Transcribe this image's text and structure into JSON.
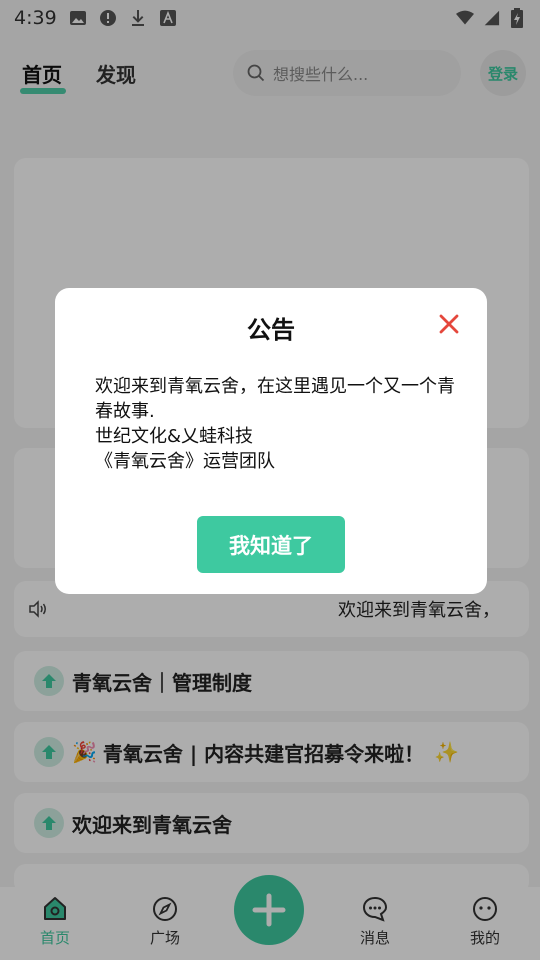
{
  "status_bar": {
    "time": "4:39",
    "icons": [
      "image-icon",
      "alert-icon",
      "download-icon",
      "font-icon"
    ],
    "right_icons": [
      "wifi-icon",
      "signal-icon",
      "battery-icon"
    ]
  },
  "header": {
    "tabs": [
      {
        "label": "首页",
        "active": true
      },
      {
        "label": "发现",
        "active": false
      }
    ],
    "search_placeholder": "想搜些什么...",
    "login_label": "登录"
  },
  "notice_bar": {
    "text": "欢迎来到青氧云舍，"
  },
  "posts": [
    {
      "title": "青氧云舍｜管理制度",
      "emoji": ""
    },
    {
      "title": "青氧云舍 | 内容共建官招募令来啦！",
      "emoji": "🎉",
      "sparkle": "✨"
    },
    {
      "title": "欢迎来到青氧云舍",
      "emoji": ""
    }
  ],
  "bottom_nav": [
    {
      "label": "首页",
      "icon": "home-icon",
      "active": true
    },
    {
      "label": "广场",
      "icon": "compass-icon",
      "active": false
    },
    {
      "label": "消息",
      "icon": "chat-icon",
      "active": false
    },
    {
      "label": "我的",
      "icon": "face-icon",
      "active": false
    }
  ],
  "dialog": {
    "title": "公告",
    "lines": [
      "欢迎来到青氧云舍，在这里遇见一个又一个青春故事.",
      "世纪文化&乂蛙科技",
      "《青氧云舍》运营团队"
    ],
    "confirm_label": "我知道了"
  },
  "colors": {
    "accent": "#3ec9a0",
    "close": "#e5473c"
  }
}
